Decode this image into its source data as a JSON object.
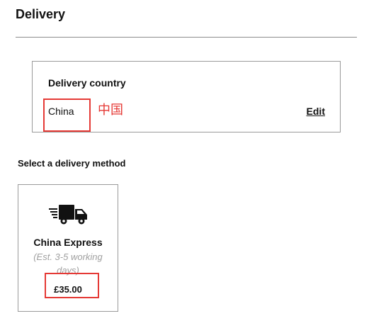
{
  "page": {
    "title": "Delivery"
  },
  "delivery_country": {
    "heading": "Delivery country",
    "value": "China",
    "edit_label": "Edit",
    "annotation": "中国"
  },
  "delivery_method": {
    "heading": "Select a delivery method",
    "options": [
      {
        "icon": "truck-icon",
        "name": "China Express",
        "eta": "(Est. 3-5 working days)",
        "price": "£35.00"
      }
    ]
  },
  "colors": {
    "annotation_red": "#e53935",
    "muted_text": "#a0a0a0",
    "border": "#9a9a9a"
  }
}
